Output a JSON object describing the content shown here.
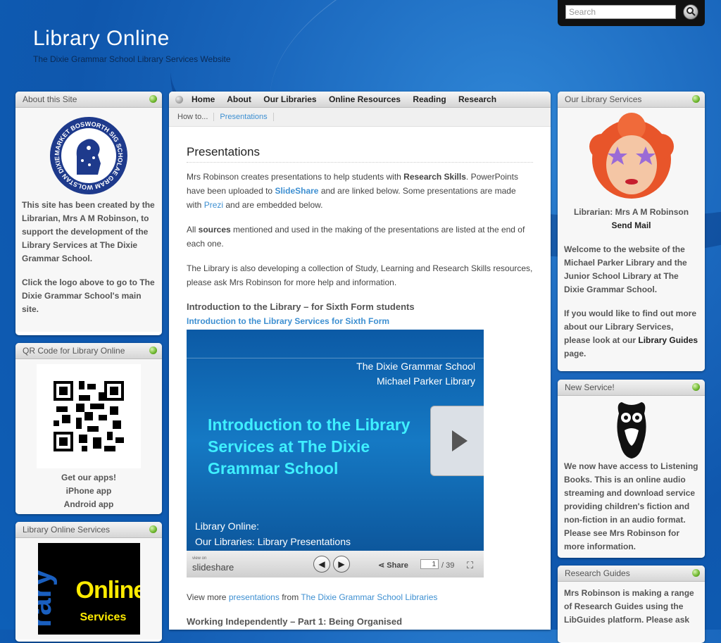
{
  "site": {
    "title": "Library Online",
    "subtitle": "The Dixie Grammar School Library Services Website"
  },
  "search": {
    "placeholder": "Search"
  },
  "nav": {
    "items": [
      "Home",
      "About",
      "Our Libraries",
      "Online Resources",
      "Reading",
      "Research"
    ]
  },
  "breadcrumb": {
    "parent": "How to...",
    "current": "Presentations"
  },
  "left": {
    "about": {
      "title": "About this Site",
      "p1": "This site has been created by the Librarian, Mrs A M Robinson, to support the development of the Library Services at The Dixie Grammar School.",
      "p2": "Click the logo above to go to The Dixie Grammar School's main site.",
      "logo_text": "MARKET BOSWORTH SIG SCHOLAE GRAM WOLSTAN DIXIE MIL DE"
    },
    "qr": {
      "title": "QR Code for Library Online",
      "apps_heading": "Get our apps!",
      "iphone": "iPhone app",
      "android": "Android app"
    },
    "services": {
      "title": "Library Online Services",
      "logo_text_1": "rary",
      "logo_text_2": "Online",
      "logo_text_3": "Services"
    }
  },
  "right": {
    "our_services": {
      "title": "Our Library Services",
      "librarian": "Librarian: Mrs A M Robinson",
      "send_mail": "Send Mail",
      "p1": "Welcome to the website of the Michael Parker Library and the Junior School Library at The Dixie Grammar School.",
      "p2a": "If you would like to find out more about our Library Services, please look at our ",
      "p2b": "Library Guides",
      "p2c": " page."
    },
    "new_service": {
      "title": "New Service!",
      "text": "We now have access to Listening Books. This is an online audio streaming and download service providing children's fiction and non-fiction in an audio format. Please see Mrs Robinson for more information."
    },
    "research_guides": {
      "title": "Research Guides",
      "text": "Mrs Robinson is making a range of Research Guides using the LibGuides platform. Please ask"
    }
  },
  "main": {
    "heading": "Presentations",
    "p1": {
      "a": "Mrs Robinson creates presentations to help students with ",
      "b": "Research Skills",
      "c": ". PowerPoints have been uploaded to ",
      "d": "SlideShare",
      "e": " and are linked below. Some presentations are made with ",
      "f": "Prezi",
      "g": " and are embedded below."
    },
    "p2": {
      "a": "All ",
      "b": "sources",
      "c": " mentioned and used in the making of the presentations are listed at the end of each one."
    },
    "p3": "The Library is also developing a collection of Study, Learning and Research Skills resources, please ask Mrs Robinson for more help and information.",
    "section1": {
      "heading": "Introduction to the Library – for Sixth Form students",
      "link": "Introduction to the Library Services for Sixth Form"
    },
    "slide": {
      "school": "The Dixie Grammar School",
      "library": "Michael Parker Library",
      "title": "Introduction to the Library Services at The Dixie Grammar School",
      "foot1": "Library Online:",
      "foot2": "Our Libraries: Library Presentations",
      "view_on": "view on",
      "brand": "slideshare",
      "share": "Share",
      "page": "1",
      "total": "/ 39"
    },
    "more": {
      "a": "View more ",
      "b": "presentations",
      "c": " from ",
      "d": "The Dixie Grammar School Libraries"
    },
    "section2": {
      "heading": "Working Independently – Part 1: Being Organised"
    }
  },
  "colors": {
    "accent": "#3d8fd1",
    "brand_bg": "#1a67bd",
    "status_green": "#6cb52c"
  }
}
